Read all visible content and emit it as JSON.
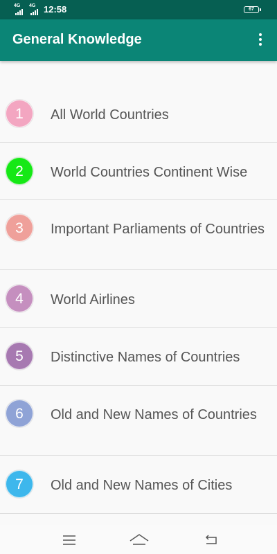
{
  "status_bar": {
    "signal_1": "4G",
    "signal_2": "4G",
    "time": "12:58",
    "battery": "67"
  },
  "app_bar": {
    "title": "General Knowledge",
    "menu_icon": "more-vert-icon"
  },
  "items": [
    {
      "number": "1",
      "label": "All World Countries",
      "color": "#f3a6c1"
    },
    {
      "number": "2",
      "label": "World Countries Continent Wise",
      "color": "#16e816"
    },
    {
      "number": "3",
      "label": "Important Parliaments of Countries",
      "color": "#efa09a"
    },
    {
      "number": "4",
      "label": "World Airlines",
      "color": "#c58fbf"
    },
    {
      "number": "5",
      "label": "Distinctive Names of Countries",
      "color": "#a779b1"
    },
    {
      "number": "6",
      "label": "Old and New Names of Countries",
      "color": "#8fa3d6"
    },
    {
      "number": "7",
      "label": "Old and New Names of Cities",
      "color": "#3db7ec"
    }
  ],
  "nav_bar": {
    "menu_icon": "menu-lines-icon",
    "home_icon": "home-icon",
    "back_icon": "back-icon"
  }
}
